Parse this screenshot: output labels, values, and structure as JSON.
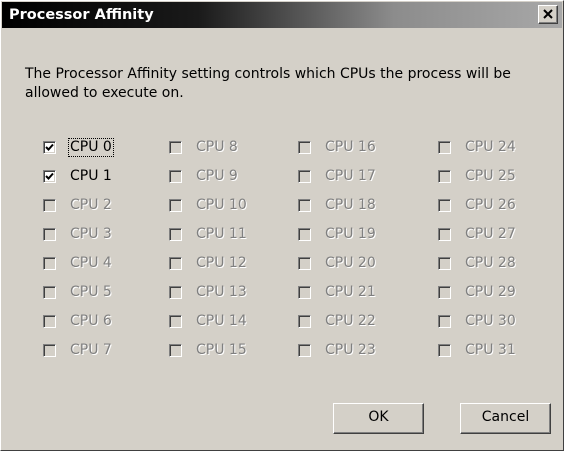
{
  "window": {
    "title": "Processor Affinity",
    "close_glyph": "close-icon"
  },
  "description": "The Processor Affinity setting controls which CPUs the process will be allowed to execute on.",
  "cpus": [
    {
      "label": "CPU 0",
      "checked": true,
      "enabled": true,
      "focused": true
    },
    {
      "label": "CPU 1",
      "checked": true,
      "enabled": true,
      "focused": false
    },
    {
      "label": "CPU 2",
      "checked": false,
      "enabled": false
    },
    {
      "label": "CPU 3",
      "checked": false,
      "enabled": false
    },
    {
      "label": "CPU 4",
      "checked": false,
      "enabled": false
    },
    {
      "label": "CPU 5",
      "checked": false,
      "enabled": false
    },
    {
      "label": "CPU 6",
      "checked": false,
      "enabled": false
    },
    {
      "label": "CPU 7",
      "checked": false,
      "enabled": false
    },
    {
      "label": "CPU 8",
      "checked": false,
      "enabled": false
    },
    {
      "label": "CPU 9",
      "checked": false,
      "enabled": false
    },
    {
      "label": "CPU 10",
      "checked": false,
      "enabled": false
    },
    {
      "label": "CPU 11",
      "checked": false,
      "enabled": false
    },
    {
      "label": "CPU 12",
      "checked": false,
      "enabled": false
    },
    {
      "label": "CPU 13",
      "checked": false,
      "enabled": false
    },
    {
      "label": "CPU 14",
      "checked": false,
      "enabled": false
    },
    {
      "label": "CPU 15",
      "checked": false,
      "enabled": false
    },
    {
      "label": "CPU 16",
      "checked": false,
      "enabled": false
    },
    {
      "label": "CPU 17",
      "checked": false,
      "enabled": false
    },
    {
      "label": "CPU 18",
      "checked": false,
      "enabled": false
    },
    {
      "label": "CPU 19",
      "checked": false,
      "enabled": false
    },
    {
      "label": "CPU 20",
      "checked": false,
      "enabled": false
    },
    {
      "label": "CPU 21",
      "checked": false,
      "enabled": false
    },
    {
      "label": "CPU 22",
      "checked": false,
      "enabled": false
    },
    {
      "label": "CPU 23",
      "checked": false,
      "enabled": false
    },
    {
      "label": "CPU 24",
      "checked": false,
      "enabled": false
    },
    {
      "label": "CPU 25",
      "checked": false,
      "enabled": false
    },
    {
      "label": "CPU 26",
      "checked": false,
      "enabled": false
    },
    {
      "label": "CPU 27",
      "checked": false,
      "enabled": false
    },
    {
      "label": "CPU 28",
      "checked": false,
      "enabled": false
    },
    {
      "label": "CPU 29",
      "checked": false,
      "enabled": false
    },
    {
      "label": "CPU 30",
      "checked": false,
      "enabled": false
    },
    {
      "label": "CPU 31",
      "checked": false,
      "enabled": false
    }
  ],
  "buttons": {
    "ok_label": "OK",
    "cancel_label": "Cancel"
  }
}
